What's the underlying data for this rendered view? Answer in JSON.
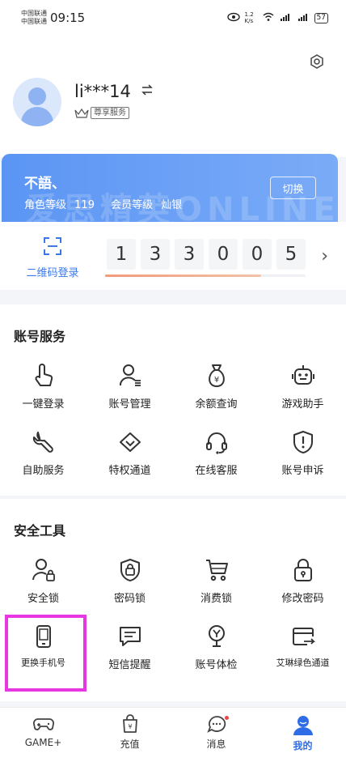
{
  "status_bar": {
    "carrier_1": "中国联通",
    "carrier_2": "中国联通",
    "time": "09:15",
    "network_speed": "1.2 K/s",
    "battery": "57"
  },
  "header": {
    "username": "li***14",
    "vip_label": "尊享服务"
  },
  "role_card": {
    "role_name": "不語、",
    "level_label": "角色等级",
    "level_value": "119",
    "member_label": "会员等级",
    "member_value": "灿银",
    "switch_label": "切换",
    "watermark": "爱思精英ONLINE"
  },
  "token_card": {
    "qr_label": "二维码登录",
    "digits": [
      "1",
      "3",
      "3",
      "0",
      "0",
      "5"
    ],
    "progress": 0.78
  },
  "account_services": {
    "title": "账号服务",
    "items": [
      {
        "label": "一键登录",
        "icon": "tap-icon"
      },
      {
        "label": "账号管理",
        "icon": "user-manage-icon"
      },
      {
        "label": "余额查询",
        "icon": "money-bag-icon"
      },
      {
        "label": "游戏助手",
        "icon": "robot-icon"
      },
      {
        "label": "自助服务",
        "icon": "wrench-icon"
      },
      {
        "label": "特权通道",
        "icon": "diamond-icon"
      },
      {
        "label": "在线客服",
        "icon": "headset-icon"
      },
      {
        "label": "账号申诉",
        "icon": "shield-alert-icon"
      }
    ]
  },
  "security_tools": {
    "title": "安全工具",
    "items": [
      {
        "label": "安全锁",
        "icon": "user-lock-icon"
      },
      {
        "label": "密码锁",
        "icon": "shield-lock-icon"
      },
      {
        "label": "消费锁",
        "icon": "cart-icon"
      },
      {
        "label": "修改密码",
        "icon": "padlock-icon"
      },
      {
        "label": "更换手机号",
        "icon": "phone-icon"
      },
      {
        "label": "短信提醒",
        "icon": "message-icon"
      },
      {
        "label": "账号体检",
        "icon": "health-check-icon"
      },
      {
        "label": "艾琳绿色通道",
        "icon": "card-transfer-icon"
      }
    ]
  },
  "tab_bar": {
    "tabs": [
      {
        "label": "GAME+"
      },
      {
        "label": "充值"
      },
      {
        "label": "消息"
      },
      {
        "label": "我的"
      }
    ]
  },
  "colors": {
    "accent": "#2f6de6",
    "highlight": "#e637e0",
    "card_blue": "#5b95f4"
  }
}
